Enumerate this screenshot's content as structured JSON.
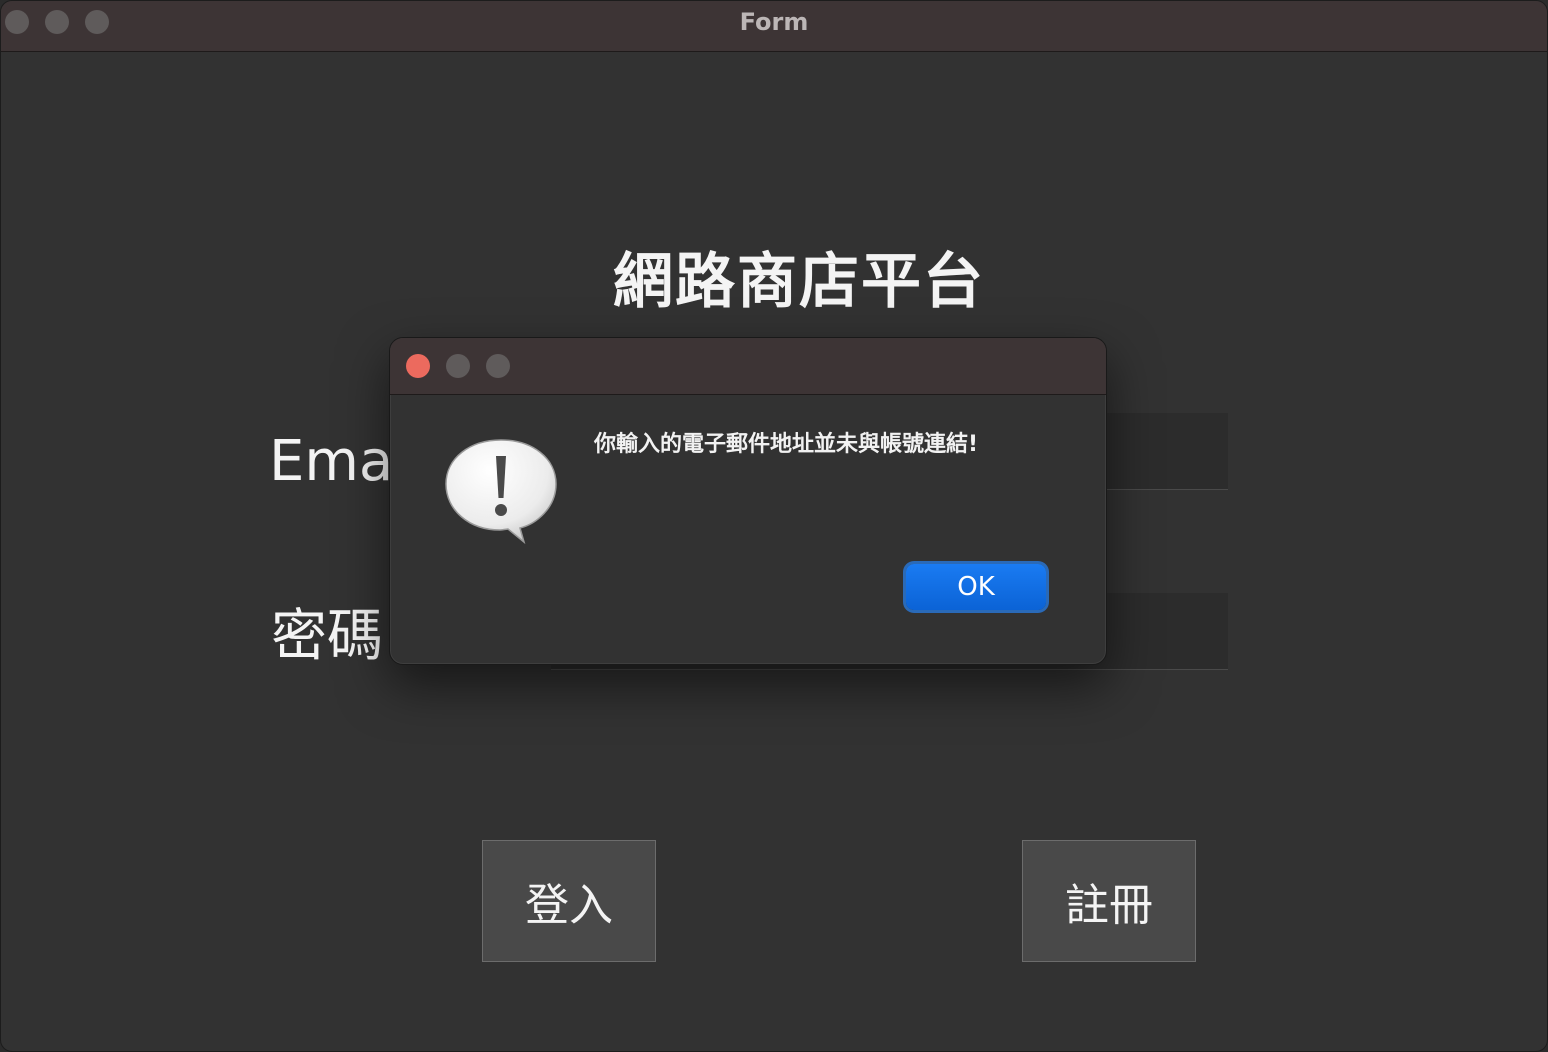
{
  "window": {
    "title": "Form"
  },
  "form": {
    "heading": "網路商店平台",
    "email_label": "Email",
    "password_label": "密碼",
    "login_button": "登入",
    "register_button": "註冊"
  },
  "alert": {
    "message": "你輸入的電子郵件地址並未與帳號連結!",
    "ok_button": "OK",
    "icon": "caution-speech-bubble-icon"
  },
  "colors": {
    "close": "#ec6a5e",
    "inactive_traffic": "#5f5b5b",
    "ok_button": "#0b63d6"
  }
}
